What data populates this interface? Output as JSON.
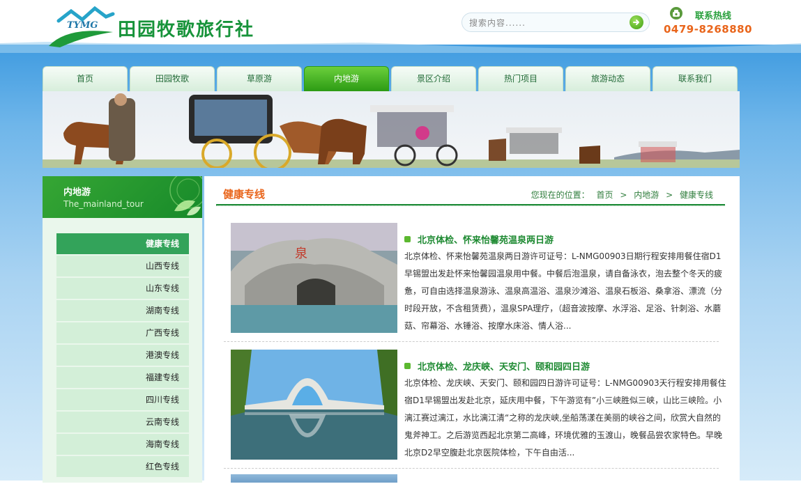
{
  "brand": {
    "logo_text": "TYMG",
    "name": "田园牧歌旅行社"
  },
  "search": {
    "placeholder": "搜索内容......"
  },
  "hotline": {
    "label": "联系热线",
    "number": "0479-8268880"
  },
  "nav": {
    "items": [
      {
        "label": "首页"
      },
      {
        "label": "田园牧歌"
      },
      {
        "label": "草原游"
      },
      {
        "label": "内地游",
        "active": true
      },
      {
        "label": "景区介绍"
      },
      {
        "label": "热门项目"
      },
      {
        "label": "旅游动态"
      },
      {
        "label": "联系我们"
      }
    ]
  },
  "sidebar": {
    "title": "内地游",
    "subtitle": "The_mainland_tour",
    "items": [
      {
        "label": "健康专线",
        "active": true
      },
      {
        "label": "山西专线"
      },
      {
        "label": "山东专线"
      },
      {
        "label": "湖南专线"
      },
      {
        "label": "广西专线"
      },
      {
        "label": "港澳专线"
      },
      {
        "label": "福建专线"
      },
      {
        "label": "四川专线"
      },
      {
        "label": "云南专线"
      },
      {
        "label": "海南专线"
      },
      {
        "label": "红色专线"
      }
    ]
  },
  "content": {
    "title": "健康专线",
    "breadcrumb": {
      "prefix": "您现在的位置：",
      "items": [
        "首页",
        "内地游",
        "健康专线"
      ],
      "separator": ">"
    },
    "articles": [
      {
        "title": "北京体检、怀来怡馨苑温泉两日游",
        "description": "北京体检、怀来怡馨苑温泉两日游许可证号：L-NMG00903日期行程安排用餐住宿D1早锡盟出发赴怀来怡馨园温泉用中餐。中餐后泡温泉，请自备泳衣，泡去整个冬天的疲惫，可自由选择温泉游泳、温泉高温浴、温泉沙滩浴、温泉石板浴、桑拿浴、漂流（分时段开放，不含租赁费），温泉SPA理疗，（超音波按摩、水浮浴、足浴、针刺浴、水蘑菇、帘幕浴、水锤浴、按摩水床浴、情人浴..."
      },
      {
        "title": "北京体检、龙庆峡、天安门、颐和园四日游",
        "description": "北京体检、龙庆峡、天安门、颐和园四日游许可证号：L-NMG00903天行程安排用餐住宿D1早锡盟出发赴北京，延庆用中餐，下午游览有”小三峡胜似三峡，山比三峡险。小漓江赛过漓江，水比漓江清“之称的龙庆峡,坐船荡漾在美丽的峡谷之间，欣赏大自然的鬼斧神工。之后游览西起北京第二高峰，环境优雅的玉渡山，晚餐品尝农家特色。早晚北京D2早空腹赴北京医院体检，下午自由活..."
      }
    ]
  },
  "colors": {
    "brand_green": "#17933a",
    "accent_orange": "#e9651b",
    "nav_active": "#2c9b14",
    "sidebar_active": "#33a35a"
  }
}
